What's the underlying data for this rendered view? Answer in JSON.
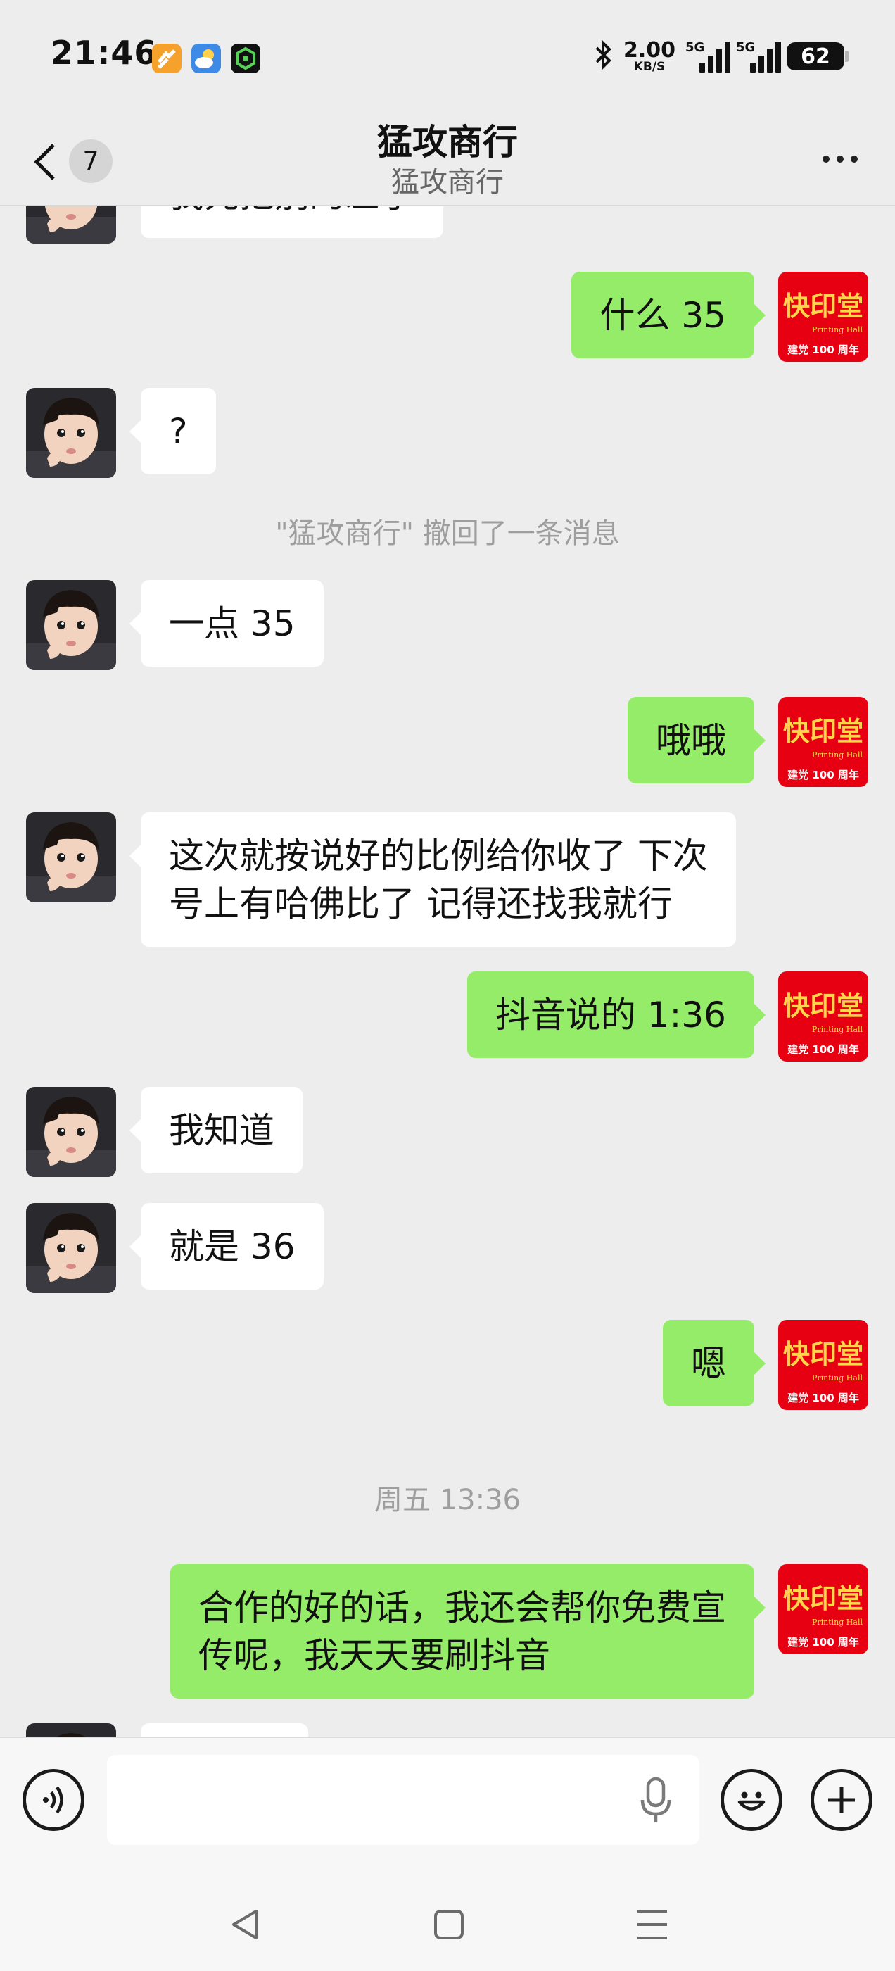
{
  "status_bar": {
    "time": "21:46",
    "net_speed": "2.00",
    "net_unit": "KB/S",
    "sim1": "5G",
    "sim2": "5G",
    "battery": "62",
    "icons": [
      "app-icon-orange",
      "weather-icon",
      "app-icon-green",
      "bluetooth-icon"
    ]
  },
  "header": {
    "unread_count": "7",
    "title": "猛攻商行",
    "subtitle": "猛攻商行"
  },
  "messages": [
    {
      "side": "in",
      "text": "我先把别的差了"
    },
    {
      "side": "out",
      "text": "什么 35"
    },
    {
      "side": "in",
      "text": "?"
    },
    {
      "side": "system",
      "text": "\"猛攻商行\" 撤回了一条消息"
    },
    {
      "side": "in",
      "text": "一点 35"
    },
    {
      "side": "out",
      "text": "哦哦"
    },
    {
      "side": "in",
      "text": "这次就按说好的比例给你收了 下次",
      "text2": "号上有哈佛比了 记得还找我就行"
    },
    {
      "side": "out",
      "text": "抖音说的 1:36"
    },
    {
      "side": "in",
      "text": "我知道"
    },
    {
      "side": "in",
      "text": "就是 36"
    },
    {
      "side": "out",
      "text": "嗯"
    },
    {
      "side": "time",
      "text": "周五 13:36"
    },
    {
      "side": "out",
      "text": "合作的好的话，我还会帮你免费宣",
      "text2": "传呢，我天天要刷抖音"
    }
  ],
  "avatar_out": {
    "logo_text": "快印堂",
    "logo_sub": "Printing Hall",
    "logo_bottom": "建党 100 周年",
    "color": "#e60012"
  },
  "input": {
    "placeholder": ""
  },
  "colors": {
    "bubble_out": "#95ec69",
    "bubble_in": "#ffffff",
    "background": "#ededed"
  }
}
